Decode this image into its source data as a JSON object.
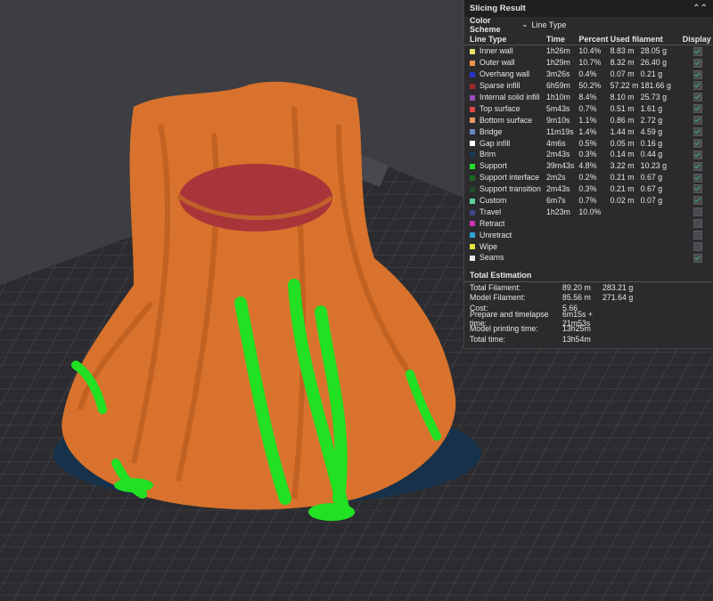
{
  "panel": {
    "title": "Slicing Result",
    "collapse_icon": "double-chevron-up-icon",
    "color_scheme_label": "Color Scheme",
    "color_scheme_value": "Line Type",
    "columns": {
      "type": "Line Type",
      "time": "Time",
      "percent": "Percent",
      "used": "Used filament",
      "display": "Display"
    },
    "lines": [
      {
        "name": "Inner wall",
        "color": "#e8e06a",
        "time": "1h26m",
        "pct": "10.4%",
        "len": "8.83 m",
        "wt": "28.05 g",
        "on": true
      },
      {
        "name": "Outer wall",
        "color": "#f09448",
        "time": "1h29m",
        "pct": "10.7%",
        "len": "8.32 m",
        "wt": "26.40 g",
        "on": true
      },
      {
        "name": "Overhang wall",
        "color": "#2a34c8",
        "time": "3m26s",
        "pct": "0.4%",
        "len": "0.07 m",
        "wt": "0.21 g",
        "on": true
      },
      {
        "name": "Sparse infill",
        "color": "#a02828",
        "time": "6h59m",
        "pct": "50.2%",
        "len": "57.22 m",
        "wt": "181.66 g",
        "on": true
      },
      {
        "name": "Internal solid infill",
        "color": "#9a4ec0",
        "time": "1h10m",
        "pct": "8.4%",
        "len": "8.10 m",
        "wt": "25.73 g",
        "on": true
      },
      {
        "name": "Top surface",
        "color": "#e04848",
        "time": "5m43s",
        "pct": "0.7%",
        "len": "0.51 m",
        "wt": "1.61 g",
        "on": true
      },
      {
        "name": "Bottom surface",
        "color": "#e89a60",
        "time": "9m10s",
        "pct": "1.1%",
        "len": "0.86 m",
        "wt": "2.72 g",
        "on": true
      },
      {
        "name": "Bridge",
        "color": "#6a84c0",
        "time": "11m19s",
        "pct": "1.4%",
        "len": "1.44 m",
        "wt": "4.59 g",
        "on": true
      },
      {
        "name": "Gap infill",
        "color": "#ffffff",
        "time": "4m6s",
        "pct": "0.5%",
        "len": "0.05 m",
        "wt": "0.16 g",
        "on": true
      },
      {
        "name": "Brim",
        "color": "#1a3a52",
        "time": "2m43s",
        "pct": "0.3%",
        "len": "0.14 m",
        "wt": "0.44 g",
        "on": true
      },
      {
        "name": "Support",
        "color": "#22e022",
        "time": "39m43s",
        "pct": "4.8%",
        "len": "3.22 m",
        "wt": "10.23 g",
        "on": true
      },
      {
        "name": "Support interface",
        "color": "#1a6a22",
        "time": "2m2s",
        "pct": "0.2%",
        "len": "0.21 m",
        "wt": "0.67 g",
        "on": true
      },
      {
        "name": "Support transition",
        "color": "#224a2a",
        "time": "2m43s",
        "pct": "0.3%",
        "len": "0.21 m",
        "wt": "0.67 g",
        "on": true
      },
      {
        "name": "Custom",
        "color": "#5ad49a",
        "time": "6m7s",
        "pct": "0.7%",
        "len": "0.02 m",
        "wt": "0.07 g",
        "on": true
      },
      {
        "name": "Travel",
        "color": "#3a4a8a",
        "time": "1h23m",
        "pct": "10.0%",
        "len": "",
        "wt": "",
        "on": false
      },
      {
        "name": "Retract",
        "color": "#d030b0",
        "time": "",
        "pct": "",
        "len": "",
        "wt": "",
        "on": false
      },
      {
        "name": "Unretract",
        "color": "#30a0d0",
        "time": "",
        "pct": "",
        "len": "",
        "wt": "",
        "on": false
      },
      {
        "name": "Wipe",
        "color": "#e8e040",
        "time": "",
        "pct": "",
        "len": "",
        "wt": "",
        "on": false
      },
      {
        "name": "Seams",
        "color": "#e8e8e8",
        "time": "",
        "pct": "",
        "len": "",
        "wt": "",
        "on": true
      }
    ],
    "totals_title": "Total Estimation",
    "totals": [
      {
        "k": "Total Filament:",
        "v1": "89.20 m",
        "v2": "283.21 g"
      },
      {
        "k": "Model Filament:",
        "v1": "85.56 m",
        "v2": "271.64 g"
      },
      {
        "k": "Cost:",
        "v1": "5.66",
        "v2": ""
      },
      {
        "k": "Prepare and timelapse time:",
        "v1": "6m15s + 21m53s",
        "v2": ""
      },
      {
        "k": "Model printing time:",
        "v1": "13h25m",
        "v2": ""
      },
      {
        "k": "Total time:",
        "v1": "13h54m",
        "v2": ""
      }
    ]
  }
}
